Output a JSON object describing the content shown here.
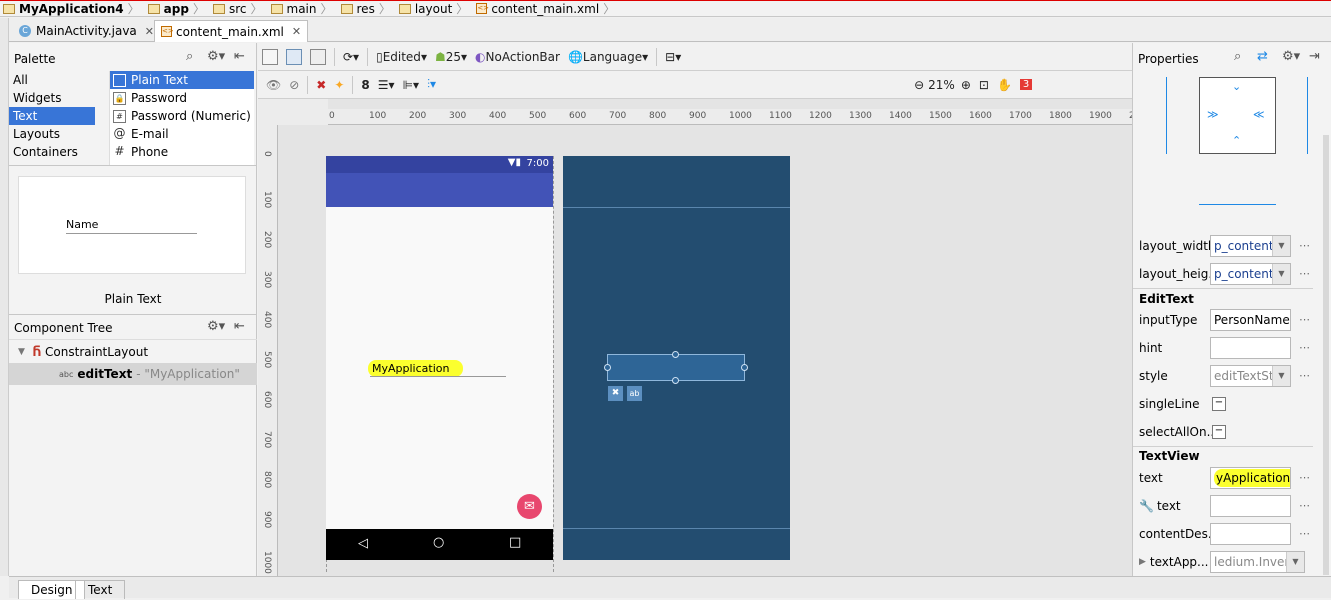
{
  "breadcrumb": [
    "MyApplication4",
    "app",
    "src",
    "main",
    "res",
    "layout",
    "content_main.xml"
  ],
  "tabs": [
    {
      "label": "MainActivity.java",
      "active": false
    },
    {
      "label": "content_main.xml",
      "active": true
    }
  ],
  "palette": {
    "title": "Palette",
    "categories": [
      "All",
      "Widgets",
      "Text",
      "Layouts",
      "Containers"
    ],
    "selected_category": "Text",
    "items": [
      "Plain Text",
      "Password",
      "Password (Numeric)",
      "E-mail",
      "Phone"
    ],
    "selected_item": "Plain Text",
    "preview_text": "Name",
    "preview_caption": "Plain Text"
  },
  "component_tree": {
    "title": "Component Tree",
    "root": "ConstraintLayout",
    "child_name": "editText",
    "child_value": "- \"MyApplication\""
  },
  "toolbar": {
    "edited": "Edited",
    "api": "25",
    "theme": "NoActionBar",
    "language": "Language",
    "margin": "8",
    "zoom": "21%",
    "warnings": "3"
  },
  "ruler": {
    "top": [
      "0",
      "100",
      "200",
      "300",
      "400",
      "500",
      "600",
      "700",
      "800",
      "900",
      "1000",
      "1100",
      "1200",
      "1300",
      "1400",
      "1500",
      "1600",
      "1700",
      "1800",
      "1900",
      "2"
    ],
    "left": [
      "0",
      "100",
      "200",
      "300",
      "400",
      "500",
      "600",
      "700",
      "800",
      "900",
      "1000"
    ]
  },
  "device": {
    "time": "7:00",
    "edittext": "MyApplication"
  },
  "properties": {
    "title": "Properties",
    "layout_width_label": "layout_width",
    "layout_width_value": "p_content",
    "layout_height_label": "layout_heig...",
    "layout_height_value": "p_content",
    "edittext_section": "EditText",
    "inputType_label": "inputType",
    "inputType_value": "PersonName",
    "hint_label": "hint",
    "hint_value": "",
    "style_label": "style",
    "style_value": "editTextSty",
    "singleLine_label": "singleLine",
    "selectAll_label": "selectAllOn...",
    "textview_section": "TextView",
    "text_label": "text",
    "text_value": "yApplication",
    "tools_text_label": "text",
    "tools_text_value": "",
    "contentDesc_label": "contentDes...",
    "contentDesc_value": "",
    "textApp_label": "textApp...",
    "textApp_value": "ledium.Inverse"
  },
  "bottom_tabs": [
    "Design",
    "Text"
  ],
  "colors": {
    "accent": "#3875d7",
    "blueprint": "#234d70",
    "appbar": "#4253b7",
    "fab": "#e8476e",
    "highlight": "#fbff2e"
  }
}
